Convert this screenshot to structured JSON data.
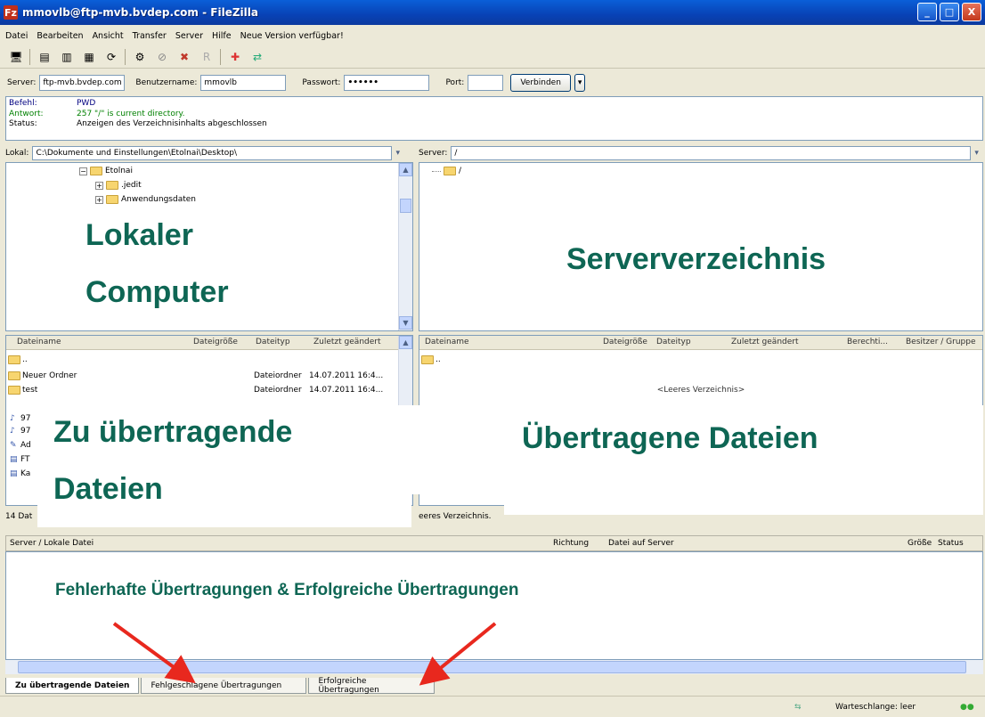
{
  "window": {
    "title": "mmovlb@ftp-mvb.bvdep.com - FileZilla",
    "app_icon_letter": "Fz",
    "controls": [
      "_",
      "□",
      "X"
    ]
  },
  "menu": [
    "Datei",
    "Bearbeiten",
    "Ansicht",
    "Transfer",
    "Server",
    "Hilfe",
    "Neue Version verfügbar!"
  ],
  "toolbar": {
    "icons": [
      "site-manager-icon",
      "toggle-log-icon",
      "toggle-local-tree-icon",
      "toggle-remote-tree-icon",
      "refresh-icon",
      "process-queue-icon",
      "cancel-icon",
      "disconnect-icon",
      "reconnect-icon",
      "filter-icon",
      "compare-icon",
      "sync-browse-icon"
    ],
    "glyphs": [
      "🖥",
      "▤",
      "▥",
      "▦",
      "⟳",
      "⚙",
      "⊘",
      "✖",
      "R",
      "✚",
      "⇄",
      "▦"
    ]
  },
  "quickconnect": {
    "server_label": "Server:",
    "server_value": "ftp-mvb.bvdep.com",
    "user_label": "Benutzername:",
    "user_value": "mmovlb",
    "pass_label": "Passwort:",
    "pass_value": "••••••",
    "port_label": "Port:",
    "port_value": "",
    "connect_label": "Verbinden",
    "dropdown_glyph": "▾"
  },
  "log": [
    {
      "key": "Befehl:",
      "value": "PWD",
      "color": "#000080"
    },
    {
      "key": "Antwort:",
      "value": "257 \"/\" is current directory.",
      "color": "#008000"
    },
    {
      "key": "Status:",
      "value": "Anzeigen des Verzeichnisinhalts abgeschlossen",
      "color": "#000000"
    }
  ],
  "local": {
    "path_label": "Lokal:",
    "path_value": "C:\\Dokumente und Einstellungen\\Etolnai\\Desktop\\",
    "tree": [
      {
        "label": "Etolnai",
        "indent": 0
      },
      {
        "label": ".jedit",
        "indent": 1
      },
      {
        "label": "Anwendungsdaten",
        "indent": 1
      }
    ],
    "columns": [
      "Dateiname",
      "Dateigröße",
      "Dateityp",
      "Zuletzt geändert"
    ],
    "rows": [
      {
        "name": "..",
        "size": "",
        "type": "",
        "modified": ""
      },
      {
        "name": "Neuer Ordner",
        "size": "",
        "type": "Dateiordner",
        "modified": "14.07.2011 16:4..."
      },
      {
        "name": "test",
        "size": "",
        "type": "Dateiordner",
        "modified": "14.07.2011 16:4..."
      },
      {
        "name": "97",
        "size": "",
        "type": "",
        "modified": ""
      },
      {
        "name": "97",
        "size": "",
        "type": "",
        "modified": ""
      },
      {
        "name": "Ad",
        "size": "",
        "type": "",
        "modified": ""
      },
      {
        "name": "FT",
        "size": "",
        "type": "",
        "modified": ""
      },
      {
        "name": "Ka",
        "size": "",
        "type": "",
        "modified": ""
      }
    ],
    "status": "14 Dat"
  },
  "remote": {
    "path_label": "Server:",
    "path_value": "/",
    "tree": [
      {
        "label": "/"
      }
    ],
    "columns": [
      "Dateiname",
      "Dateigröße",
      "Dateityp",
      "Zuletzt geändert",
      "Berechti...",
      "Besitzer / Gruppe"
    ],
    "rows": [
      {
        "name": ".."
      }
    ],
    "empty_text": "<Leeres Verzeichnis>",
    "status": "eeres Verzeichnis."
  },
  "queue": {
    "columns": [
      "Server / Lokale Datei",
      "Richtung",
      "Datei auf Server",
      "Größe",
      "Status"
    ]
  },
  "tabs": [
    "Zu übertragende Dateien",
    "Fehlgeschlagene Übertragungen",
    "Erfolgreiche Übertragungen"
  ],
  "statusbar": {
    "queue_text": "Warteschlange: leer"
  },
  "annotations": {
    "local": [
      "Lokaler",
      "Computer"
    ],
    "server": "Serververzeichnis",
    "to_transfer": [
      "Zu übertragende",
      "Dateien"
    ],
    "transferred": "Übertragene Dateien",
    "queue_note": "Fehlerhafte Übertragungen & Erfolgreiche Übertragungen",
    "label_color": "#0e6654",
    "arrow_color": "#e8281e"
  }
}
